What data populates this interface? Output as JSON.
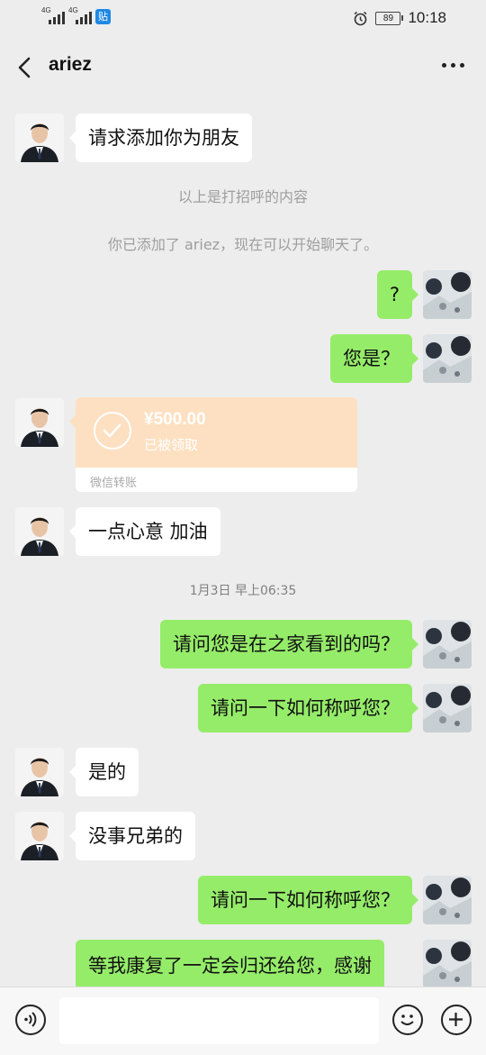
{
  "status_bar": {
    "signal1_label": "4G",
    "signal2_label": "4G",
    "app_badge": "贴",
    "battery": "89",
    "time": "10:18"
  },
  "header": {
    "title": "ariez"
  },
  "messages": {
    "m1": "请求添加你为朋友",
    "sys1": "以上是打招呼的内容",
    "sys2": "你已添加了 ariez，现在可以开始聊天了。",
    "m2": "?",
    "m3": "您是？",
    "transfer": {
      "amount": "¥500.00",
      "status": "已被领取",
      "label": "微信转账"
    },
    "m4": "一点心意 加油",
    "time1": "1月3日 早上06:35",
    "m5": "请问您是在之家看到的吗？",
    "m6": "请问一下如何称呼您？",
    "m7": "是的",
    "m8": "没事兄弟的",
    "m9": "请问一下如何称呼您？",
    "m10": "等我康复了一定会归还给您，感谢"
  },
  "input": {
    "placeholder": ""
  },
  "colors": {
    "outgoing_bubble": "#95ec69",
    "incoming_bubble": "#ffffff",
    "transfer_card": "#fde0c1",
    "background": "#ededed"
  }
}
